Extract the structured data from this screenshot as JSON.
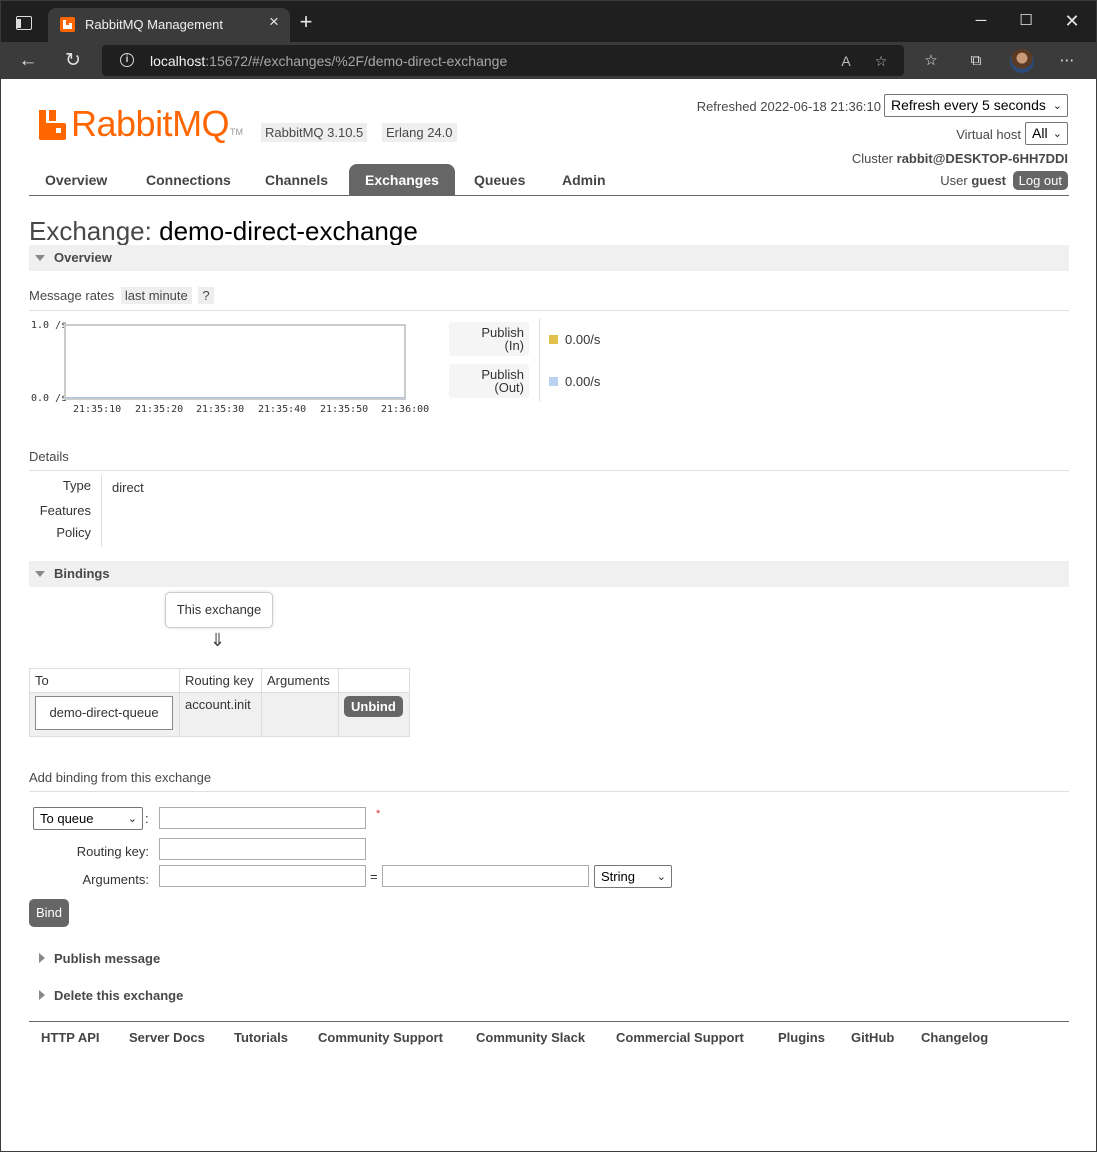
{
  "browser": {
    "tab_title": "RabbitMQ Management",
    "url_host": "localhost",
    "url_rest": ":15672/#/exchanges/%2F/demo-direct-exchange"
  },
  "header": {
    "logo_text": "RabbitMQ",
    "logo_tm": "TM",
    "version": "RabbitMQ 3.10.5",
    "erlang": "Erlang 24.0",
    "refreshed_label": "Refreshed 2022-06-18 21:36:10",
    "refresh_select": "Refresh every 5 seconds",
    "vhost_label": "Virtual host",
    "vhost_select": "All",
    "cluster_label": "Cluster",
    "cluster_name": "rabbit@DESKTOP-6HH7DDI",
    "user_label": "User",
    "user_name": "guest",
    "logout": "Log out"
  },
  "nav": [
    "Overview",
    "Connections",
    "Channels",
    "Exchanges",
    "Queues",
    "Admin"
  ],
  "page": {
    "title_prefix": "Exchange:",
    "title_name": "demo-direct-exchange"
  },
  "overview": {
    "section": "Overview",
    "rates_label": "Message rates",
    "rates_range": "last minute",
    "help": "?",
    "publish_in_l1": "Publish",
    "publish_in_l2": "(In)",
    "publish_in_value": "0.00/s",
    "publish_out_l1": "Publish",
    "publish_out_l2": "(Out)",
    "publish_out_value": "0.00/s",
    "colors": {
      "publish_in": "#e0c14b",
      "publish_out": "#b8d2f0"
    }
  },
  "chart_data": {
    "type": "line",
    "x": [
      "21:35:10",
      "21:35:20",
      "21:35:30",
      "21:35:40",
      "21:35:50",
      "21:36:00"
    ],
    "series": [
      {
        "values": [
          0,
          0,
          0,
          0,
          0,
          0
        ]
      },
      {
        "values": [
          0,
          0,
          0,
          0,
          0,
          0
        ]
      }
    ],
    "y_tick_labels": [
      "1.0 /s",
      "0.0 /s"
    ],
    "ylim": [
      0,
      1
    ]
  },
  "details": {
    "label": "Details",
    "type_key": "Type",
    "type_value": "direct",
    "features_key": "Features",
    "policy_key": "Policy"
  },
  "bindings": {
    "section": "Bindings",
    "this_exchange": "This exchange",
    "arrow": "⇓",
    "headers": [
      "To",
      "Routing key",
      "Arguments",
      ""
    ],
    "row": {
      "to": "demo-direct-queue",
      "routing_key": "account.init",
      "arguments": "",
      "action": "Unbind"
    }
  },
  "add_binding": {
    "label": "Add binding from this exchange",
    "dest_select": "To queue",
    "colon": ":",
    "required": "*",
    "routing_key_label": "Routing key:",
    "arguments_label": "Arguments:",
    "equals": "=",
    "arg_type": "String",
    "bind_button": "Bind"
  },
  "collapsed_sections": [
    "Publish message",
    "Delete this exchange"
  ],
  "footer": [
    "HTTP API",
    "Server Docs",
    "Tutorials",
    "Community Support",
    "Community Slack",
    "Commercial Support",
    "Plugins",
    "GitHub",
    "Changelog"
  ]
}
